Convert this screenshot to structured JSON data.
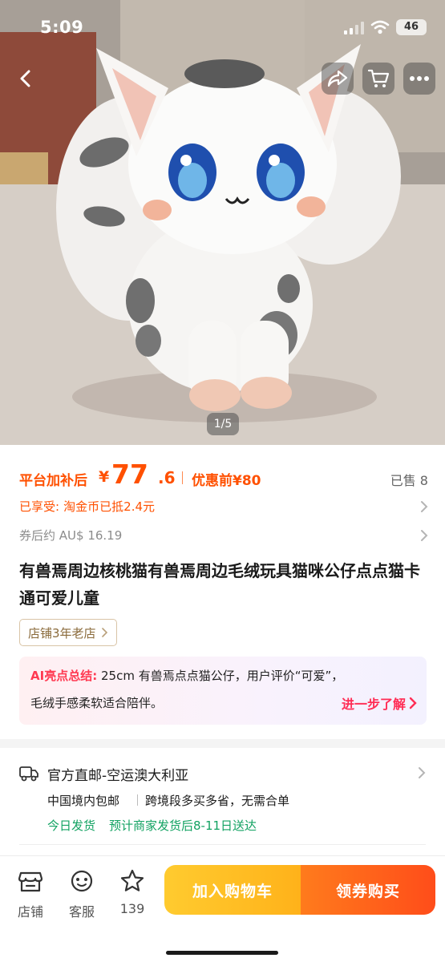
{
  "status_bar": {
    "time": "5:09",
    "battery": "46"
  },
  "hero": {
    "image_alt": "White plush cat toy with grey spots and big blue eyes",
    "page_counter": "1/5"
  },
  "price": {
    "prefix": "平台加补后",
    "symbol": "¥",
    "integer": "77",
    "decimal": ".6",
    "before_label": "优惠前¥80",
    "sold": "已售 8"
  },
  "subsidy": {
    "label": "已享受:",
    "value": "淘金币已抵2.4元"
  },
  "coupon_aud": "券后约 AU$ 16.19",
  "title": "有兽焉周边核桃猫有兽焉周边毛绒玩具猫咪公仔点点猫卡通可爱儿童",
  "shop_badge": "店铺3年老店",
  "ai_summary": {
    "label": "AI亮点总结:",
    "line1": "25cm 有兽焉点点猫公仔，用户评价“可爱”，",
    "line2": "毛绒手感柔软适合陪伴。",
    "more": "进一步了解"
  },
  "shipping": {
    "method": "官方直邮-空运澳大利亚",
    "free_domestic": "中国境内包邮",
    "cross_border": "跨境段多买多省，无需合单",
    "today": "今日发货",
    "eta": "预计商家发货后8-11日送达"
  },
  "bottom_bar": {
    "shop": "店铺",
    "service": "客服",
    "favorites": "139",
    "add_to_cart": "加入购物车",
    "buy": "领券购买"
  },
  "colors": {
    "accent": "#ff5000",
    "ai_accent": "#ff2d55",
    "green": "#12a262",
    "cart_button": "#ffb21a",
    "buy_button": "#ff4d1a"
  },
  "icons": [
    "back-icon",
    "share-icon",
    "cart-icon",
    "more-icon",
    "chevron-right-icon",
    "truck-icon",
    "shop-icon",
    "service-icon",
    "star-icon"
  ]
}
